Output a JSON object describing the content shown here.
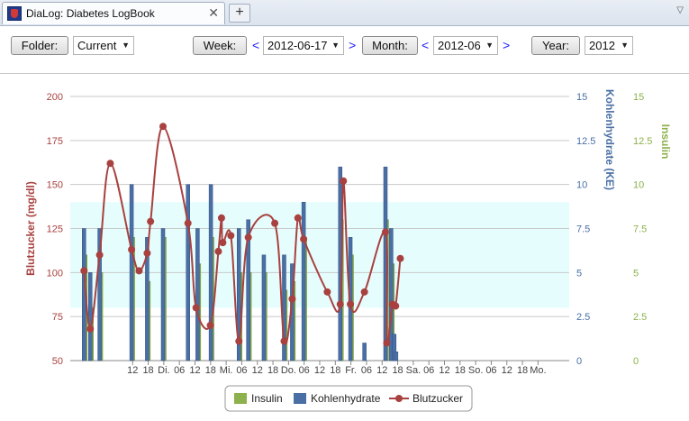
{
  "tab": {
    "title": "DiaLog: Diabetes LogBook",
    "close": "✕",
    "new_tab": "+",
    "menu": "▽"
  },
  "toolbar": {
    "folder_label": "Folder:",
    "folder_value": "Current",
    "week_label": "Week:",
    "week_value": "2012-06-17",
    "month_label": "Month:",
    "month_value": "2012-06",
    "year_label": "Year:",
    "year_value": "2012",
    "prev": "<",
    "next": ">"
  },
  "colors": {
    "blutzucker": "#a8413f",
    "kohlenhydrate": "#4a6fa5",
    "insulin": "#8db14c",
    "band": "#e6fdfd",
    "link": "#1a1aff"
  },
  "chart_data": {
    "type": "line",
    "title": "",
    "axes": {
      "y_left": {
        "label": "Blutzucker (mg/dl)",
        "min": 50,
        "max": 200,
        "ticks": [
          50,
          75,
          100,
          125,
          150,
          175,
          200
        ],
        "color": "#a8413f"
      },
      "y_right1": {
        "label": "Kohlenhydrate (KE)",
        "min": 0,
        "max": 15,
        "ticks": [
          0,
          2.5,
          5,
          7.5,
          10,
          12.5,
          15
        ],
        "color": "#4a6fa5"
      },
      "y_right2": {
        "label": "Insulin",
        "min": 0,
        "max": 15,
        "ticks": [
          0,
          2.5,
          5,
          7.5,
          10,
          12.5,
          15
        ],
        "color": "#8db14c"
      }
    },
    "target_range": [
      80,
      140
    ],
    "x_range_hours": [
      -12,
      180
    ],
    "x_ticks": [
      {
        "h": 12,
        "label": "12"
      },
      {
        "h": 18,
        "label": "18"
      },
      {
        "h": 24,
        "label": "Di."
      },
      {
        "h": 30,
        "label": "06"
      },
      {
        "h": 36,
        "label": "12"
      },
      {
        "h": 42,
        "label": "18"
      },
      {
        "h": 48,
        "label": "Mi."
      },
      {
        "h": 54,
        "label": "06"
      },
      {
        "h": 60,
        "label": "12"
      },
      {
        "h": 66,
        "label": "18"
      },
      {
        "h": 72,
        "label": "Do."
      },
      {
        "h": 78,
        "label": "06"
      },
      {
        "h": 84,
        "label": "12"
      },
      {
        "h": 90,
        "label": "18"
      },
      {
        "h": 96,
        "label": "Fr."
      },
      {
        "h": 102,
        "label": "06"
      },
      {
        "h": 108,
        "label": "12"
      },
      {
        "h": 114,
        "label": "18"
      },
      {
        "h": 120,
        "label": "Sa."
      },
      {
        "h": 126,
        "label": "06"
      },
      {
        "h": 132,
        "label": "12"
      },
      {
        "h": 138,
        "label": "18"
      },
      {
        "h": 144,
        "label": "So."
      },
      {
        "h": 150,
        "label": "06"
      },
      {
        "h": 156,
        "label": "12"
      },
      {
        "h": 162,
        "label": "18"
      },
      {
        "h": 168,
        "label": "Mo."
      }
    ],
    "series": [
      {
        "name": "Blutzucker",
        "axis": "y_left",
        "kind": "spline",
        "points": [
          [
            -6.7,
            101
          ],
          [
            -4.3,
            68
          ],
          [
            -0.7,
            110
          ],
          [
            3.4,
            162
          ],
          [
            11.6,
            113
          ],
          [
            14.5,
            101
          ],
          [
            17.6,
            111
          ],
          [
            18.9,
            129
          ],
          [
            23.7,
            183
          ],
          [
            33.3,
            128
          ],
          [
            36.4,
            80
          ],
          [
            41.9,
            70
          ],
          [
            45.0,
            112
          ],
          [
            46.2,
            131
          ],
          [
            46.7,
            117
          ],
          [
            49.8,
            121
          ],
          [
            52.9,
            61
          ],
          [
            56.5,
            120
          ],
          [
            66.7,
            128
          ],
          [
            70.3,
            61
          ],
          [
            73.4,
            85
          ],
          [
            75.6,
            131
          ],
          [
            77.8,
            119
          ],
          [
            86.9,
            89
          ],
          [
            91.9,
            82
          ],
          [
            93.1,
            152
          ],
          [
            95.8,
            82
          ],
          [
            101.2,
            89
          ],
          [
            109.3,
            123
          ],
          [
            109.8,
            60
          ],
          [
            112.0,
            82
          ],
          [
            113.2,
            81
          ],
          [
            115.0,
            108
          ]
        ]
      },
      {
        "name": "Kohlenhydrate",
        "axis": "y_right1",
        "kind": "bar",
        "points": [
          [
            -6.7,
            7.5
          ],
          [
            -4.3,
            5
          ],
          [
            -0.7,
            7.5
          ],
          [
            11.6,
            10
          ],
          [
            17.6,
            7
          ],
          [
            23.7,
            7.5
          ],
          [
            33.3,
            10
          ],
          [
            37.0,
            7.5
          ],
          [
            42.1,
            10
          ],
          [
            52.9,
            7.5
          ],
          [
            56.5,
            8
          ],
          [
            62.5,
            6
          ],
          [
            70.3,
            6
          ],
          [
            73.4,
            5.5
          ],
          [
            77.8,
            9
          ],
          [
            91.9,
            11
          ],
          [
            95.8,
            7
          ],
          [
            101.2,
            1
          ],
          [
            109.3,
            11
          ],
          [
            111.5,
            7.5
          ],
          [
            112.7,
            1.5
          ],
          [
            113.4,
            0.5
          ]
        ]
      },
      {
        "name": "Insulin",
        "axis": "y_right2",
        "kind": "bar",
        "points": [
          [
            -6.2,
            6
          ],
          [
            -3.8,
            3
          ],
          [
            -0.2,
            5
          ],
          [
            12.1,
            7
          ],
          [
            18.1,
            4.5
          ],
          [
            24.2,
            7
          ],
          [
            37.5,
            5.5
          ],
          [
            42.6,
            7
          ],
          [
            53.4,
            5
          ],
          [
            57.0,
            5
          ],
          [
            63.0,
            5
          ],
          [
            70.8,
            4
          ],
          [
            73.9,
            4.5
          ],
          [
            78.3,
            7
          ],
          [
            92.4,
            8
          ],
          [
            96.3,
            6
          ],
          [
            109.8,
            8
          ],
          [
            112.0,
            5.5
          ]
        ]
      }
    ],
    "legend": {
      "position": "bottom-center",
      "items": [
        "Insulin",
        "Kohlenhydrate",
        "Blutzucker"
      ]
    }
  }
}
